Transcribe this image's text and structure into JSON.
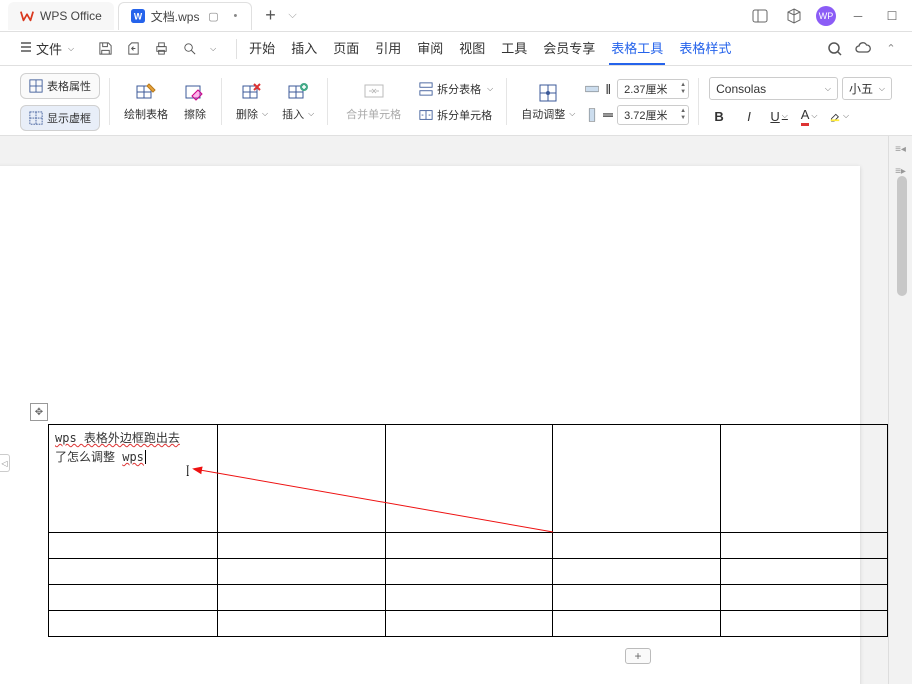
{
  "titlebar": {
    "app_name": "WPS Office",
    "doc_name": "文档.wps",
    "avatar": "WP"
  },
  "menu": {
    "file": "文件",
    "tabs": {
      "start": "开始",
      "insert": "插入",
      "page": "页面",
      "reference": "引用",
      "review": "审阅",
      "view": "视图",
      "tools": "工具",
      "member": "会员专享",
      "table_tools": "表格工具",
      "table_style": "表格样式"
    }
  },
  "ribbon": {
    "table_props": "表格属性",
    "show_marks": "显示虚框",
    "draw_table": "绘制表格",
    "eraser": "擦除",
    "delete": "删除",
    "insert": "插入",
    "merge_cells": "合并单元格",
    "split_table": "拆分表格",
    "split_cells": "拆分单元格",
    "auto_fit": "自动调整",
    "width_value": "2.37厘米",
    "height_value": "3.72厘米",
    "font_name": "Consolas",
    "font_size": "小五"
  },
  "doc": {
    "cell_text_line1": "wps 表格外边框跑出去",
    "cell_text_line2_a": "了怎么调整 ",
    "cell_text_line2_b": "wps"
  }
}
